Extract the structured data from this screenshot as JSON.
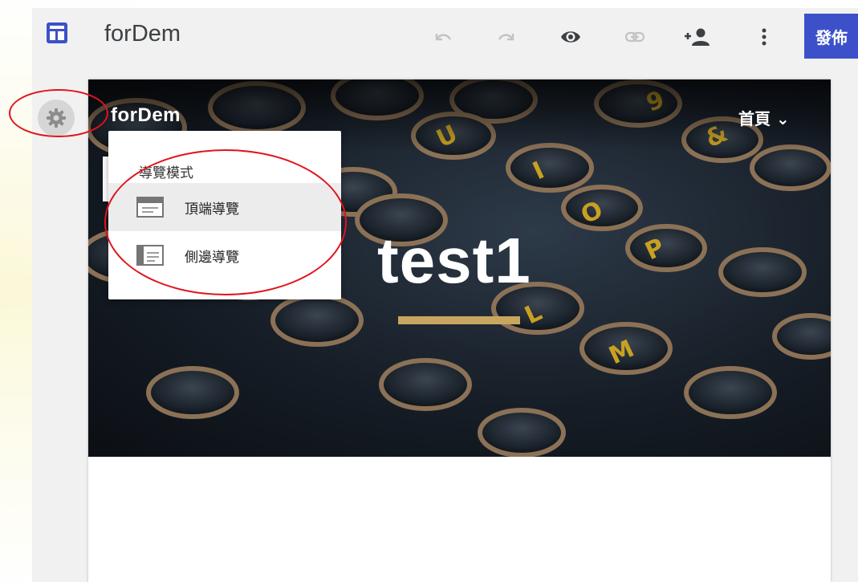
{
  "topbar": {
    "title": "forDem",
    "publish_label": "發佈",
    "icons": [
      "site-layout-icon",
      "undo-icon",
      "redo-icon",
      "preview-eye-icon",
      "link-icon",
      "share-add-person-icon",
      "more-vert-icon"
    ]
  },
  "settings": {
    "icon": "gear-icon"
  },
  "site": {
    "name": "forDem",
    "nav_home": "首頁 ⌄",
    "hero_title": "test1"
  },
  "nav_menu": {
    "heading": "導覽模式",
    "items": [
      {
        "label": "頂端導覽",
        "icon": "top-nav-icon",
        "selected": true
      },
      {
        "label": "側邊導覽",
        "icon": "side-nav-icon",
        "selected": false
      }
    ]
  },
  "colors": {
    "accent": "#3c51c9",
    "annotation": "#e0141c",
    "hero_bar": "#c9a660"
  }
}
